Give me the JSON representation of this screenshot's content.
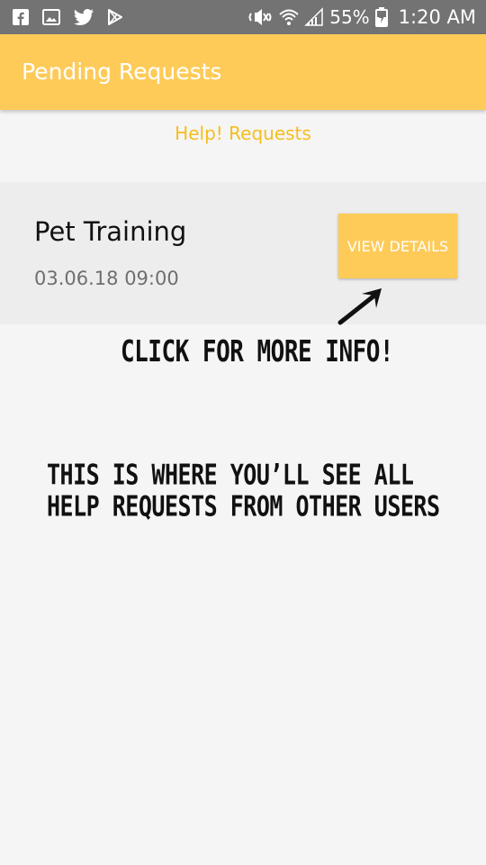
{
  "status_bar": {
    "icons_left": [
      "facebook-icon",
      "gallery-icon",
      "twitter-icon",
      "play-store-icon"
    ],
    "icons_right": [
      "mute-icon",
      "wifi-icon",
      "signal-icon",
      "battery-icon"
    ],
    "battery_text": "55%",
    "time": "1:20 AM"
  },
  "app_bar": {
    "title": "Pending Requests"
  },
  "section": {
    "header": "Help! Requests"
  },
  "requests": [
    {
      "title": "Pet Training",
      "datetime": "03.06.18 09:00",
      "button_label": "VIEW DETAILS"
    }
  ],
  "annotations": {
    "click_hint": "CLICK FOR MORE INFO!",
    "description": "THIS IS WHERE YOU’LL SEE ALL HELP REQUESTS FROM OTHER USERS"
  },
  "colors": {
    "accent": "#fecb59",
    "header_text": "#f5be1d",
    "status_bar": "#737373",
    "card_bg": "#ededed",
    "background": "#f6f5f5"
  }
}
